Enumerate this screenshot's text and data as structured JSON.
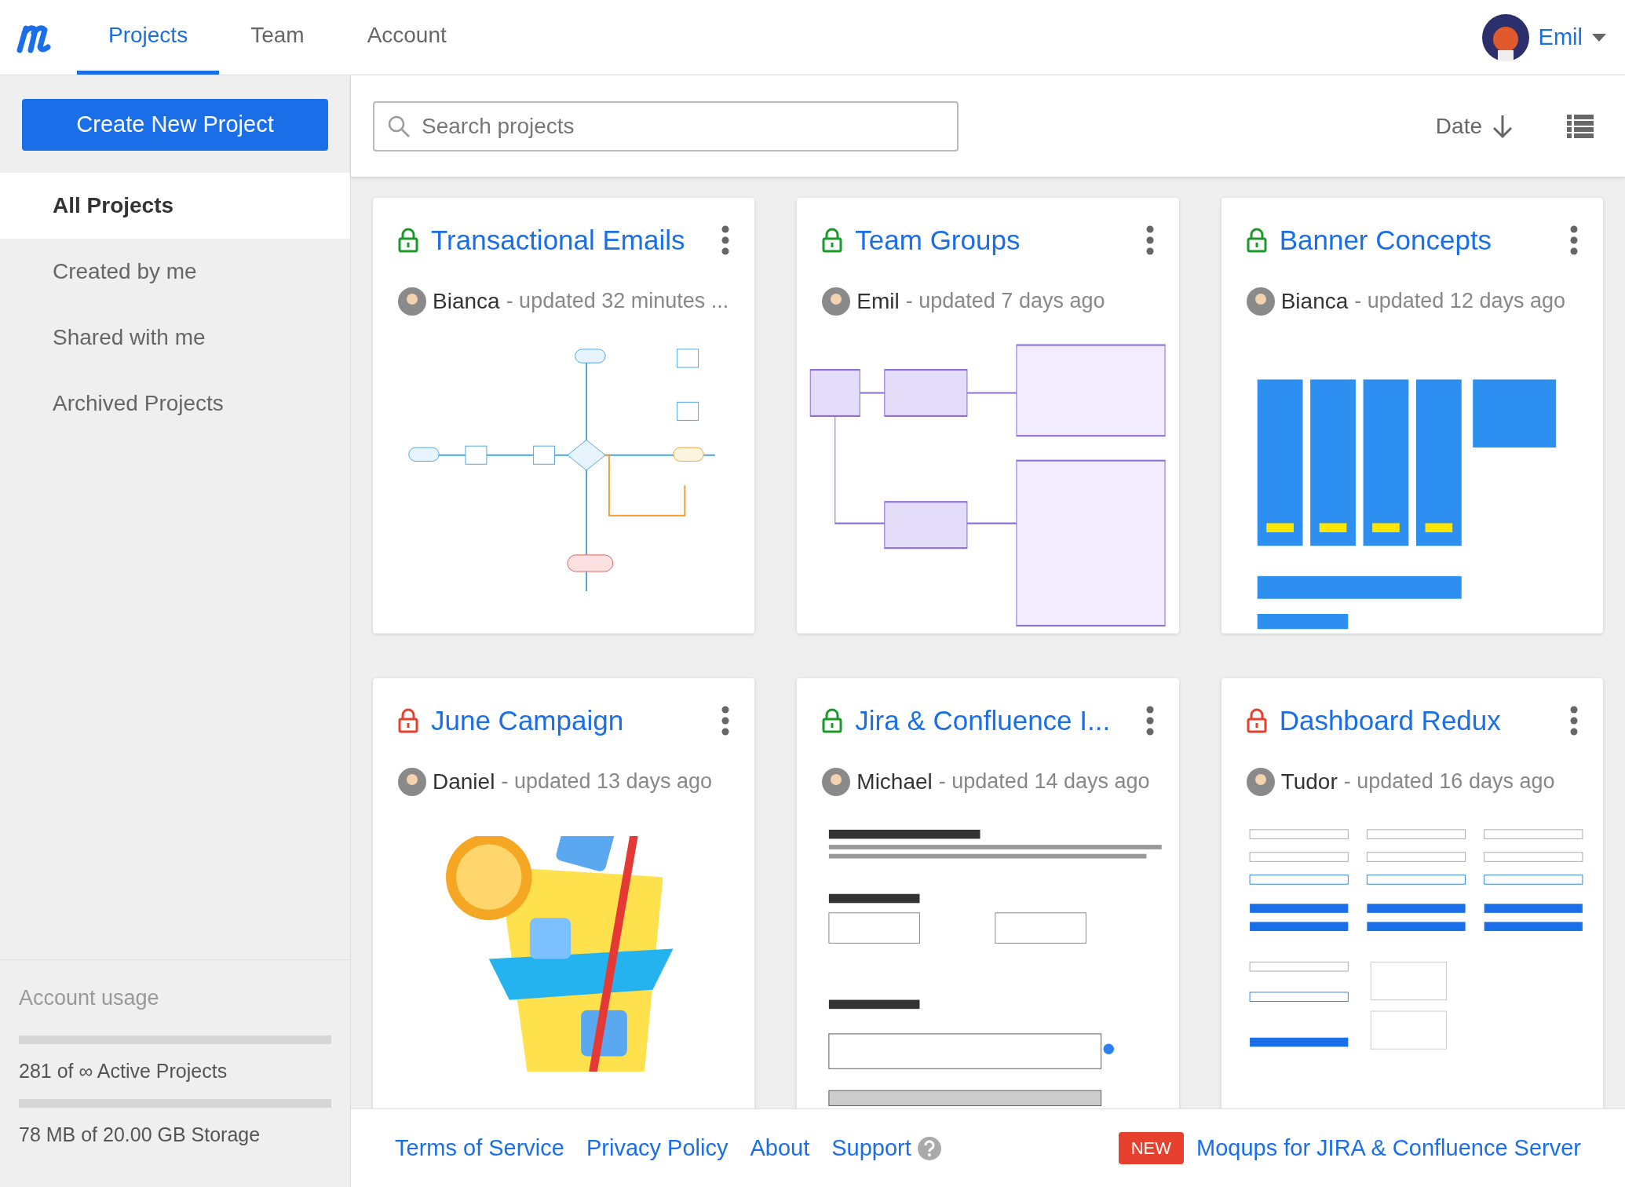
{
  "header": {
    "tabs": [
      {
        "label": "Projects",
        "selected": true
      },
      {
        "label": "Team",
        "selected": false
      },
      {
        "label": "Account",
        "selected": false
      }
    ],
    "user": {
      "name": "Emil"
    }
  },
  "sidebar": {
    "create_button": "Create New Project",
    "items": [
      {
        "label": "All Projects",
        "selected": true
      },
      {
        "label": "Created by me",
        "selected": false
      },
      {
        "label": "Shared with me",
        "selected": false
      },
      {
        "label": "Archived Projects",
        "selected": false
      }
    ],
    "usage": {
      "title": "Account usage",
      "meters": [
        {
          "label": "281 of ∞ Active Projects"
        },
        {
          "label": "78 MB of 20.00 GB Storage"
        }
      ]
    }
  },
  "toolbar": {
    "search": {
      "placeholder": "Search projects"
    },
    "sort": "Date"
  },
  "projects": [
    {
      "title": "Transactional Emails",
      "color": "#1a9a2a",
      "author": "Bianca",
      "updated": "- updated 32 minutes ...",
      "thumbnail": {
        "kind": "flowchart"
      }
    },
    {
      "title": "Team Groups",
      "color": "#1a9a2a",
      "author": "Emil",
      "updated": "- updated 7 days ago",
      "thumbnail": {
        "kind": "diagram"
      }
    },
    {
      "title": "Banner Concepts",
      "color": "#1a9a2a",
      "author": "Bianca",
      "updated": "- updated 12 days ago",
      "thumbnail": {
        "kind": "banners"
      }
    },
    {
      "title": "June Campaign",
      "color": "#e8402f",
      "author": "Daniel",
      "updated": "- updated 13 days ago",
      "thumbnail": {
        "kind": "illustration"
      }
    },
    {
      "title": "Jira & Confluence I...",
      "color": "#1a9a2a",
      "author": "Michael",
      "updated": "- updated 14 days ago",
      "thumbnail": {
        "kind": "form"
      }
    },
    {
      "title": "Dashboard Redux",
      "color": "#e8402f",
      "author": "Tudor",
      "updated": "- updated 16 days ago",
      "thumbnail": {
        "kind": "forms"
      }
    }
  ],
  "footer": {
    "links": [
      "Terms of Service",
      "Privacy Policy",
      "About",
      "Support"
    ],
    "badge": "NEW",
    "promo": "Moqups for JIRA & Confluence Server"
  }
}
